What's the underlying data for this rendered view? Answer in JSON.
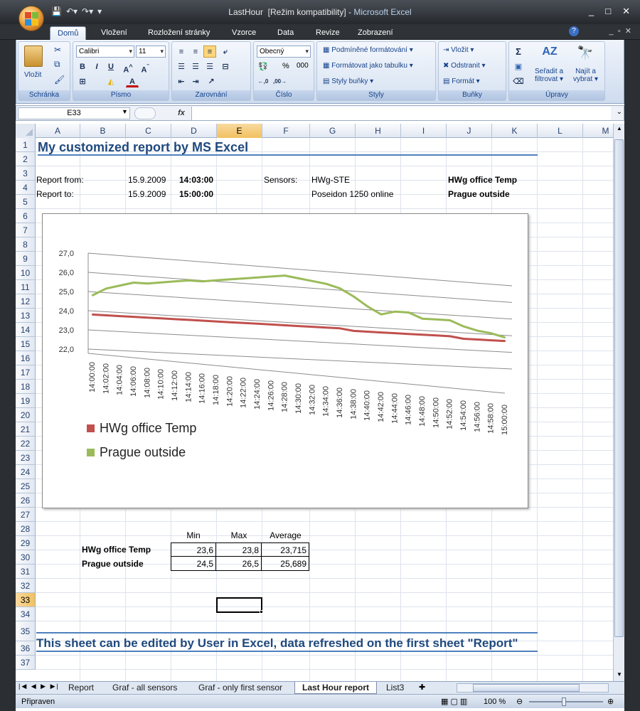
{
  "window": {
    "filename": "LastHour",
    "mode": "[Režim kompatibility]",
    "separator": " - ",
    "app": "Microsoft Excel"
  },
  "ribbon_tabs": [
    "Domů",
    "Vložení",
    "Rozložení stránky",
    "Vzorce",
    "Data",
    "Revize",
    "Zobrazení"
  ],
  "ribbon": {
    "clipboard": {
      "paste": "Vložit",
      "label": "Schránka"
    },
    "font": {
      "name": "Calibri",
      "size": "11",
      "label": "Písmo"
    },
    "alignment": {
      "label": "Zarovnání"
    },
    "number": {
      "format": "Obecný",
      "percent": "%",
      "thousands": "000",
      "label": "Číslo"
    },
    "styles": {
      "conditional": "Podmíněné formátování",
      "as_table": "Formátovat jako tabulku",
      "cell_styles": "Styly buňky",
      "label": "Styly"
    },
    "cells": {
      "insert": "Vložit",
      "delete": "Odstranit",
      "format": "Formát",
      "label": "Buňky"
    },
    "editing": {
      "sort1": "Seřadit a",
      "sort2": "filtrovat",
      "find1": "Najít a",
      "find2": "vybrat",
      "label": "Úpravy"
    }
  },
  "formula_bar": {
    "name_box": "E33",
    "fx": "fx",
    "formula": ""
  },
  "columns": [
    "A",
    "B",
    "C",
    "D",
    "E",
    "F",
    "G",
    "H",
    "I",
    "J",
    "K",
    "L",
    "M"
  ],
  "rows": [
    "1",
    "2",
    "3",
    "4",
    "5",
    "6",
    "7",
    "8",
    "9",
    "10",
    "11",
    "12",
    "13",
    "14",
    "15",
    "16",
    "17",
    "18",
    "19",
    "20",
    "21",
    "22",
    "23",
    "24",
    "25",
    "26",
    "27",
    "28",
    "29",
    "30",
    "31",
    "32",
    "33",
    "34",
    "35",
    "36",
    "37"
  ],
  "sheet": {
    "title": "My customized report by MS Excel",
    "report_from_label": "Report from:",
    "report_from_date": "15.9.2009",
    "report_from_time": "14:03:00",
    "report_to_label": "Report to:",
    "report_to_date": "15.9.2009",
    "report_to_time": "15:00:00",
    "sensors_label": "Sensors:",
    "sensor1_device": "HWg-STE",
    "sensor2_device": "Poseidon 1250 online",
    "sensor1_name": "HWg office Temp",
    "sensor2_name": "Prague outside",
    "stats_headers": [
      "Min",
      "Max",
      "Average"
    ],
    "stats_rows": [
      {
        "name": "HWg office Temp",
        "min": "23,6",
        "max": "23,8",
        "avg": "23,715"
      },
      {
        "name": "Prague outside",
        "min": "24,5",
        "max": "26,5",
        "avg": "25,689"
      }
    ],
    "footer": "This sheet can be edited by User in Excel, data refreshed on the first sheet \"Report\""
  },
  "chart_data": {
    "type": "line",
    "x": [
      "14:00:00",
      "14:02:00",
      "14:04:00",
      "14:06:00",
      "14:08:00",
      "14:10:00",
      "14:12:00",
      "14:14:00",
      "14:16:00",
      "14:18:00",
      "14:20:00",
      "14:22:00",
      "14:24:00",
      "14:26:00",
      "14:28:00",
      "14:30:00",
      "14:32:00",
      "14:34:00",
      "14:36:00",
      "14:38:00",
      "14:40:00",
      "14:42:00",
      "14:44:00",
      "14:46:00",
      "14:48:00",
      "14:50:00",
      "14:52:00",
      "14:54:00",
      "14:56:00",
      "14:58:00",
      "15:00:00"
    ],
    "y_ticks": [
      "22,0",
      "23,0",
      "24,0",
      "25,0",
      "26,0",
      "27,0"
    ],
    "ylim": [
      22,
      27
    ],
    "series": [
      {
        "name": "HWg office Temp",
        "color": "#c0504d",
        "values": [
          23.8,
          23.8,
          23.8,
          23.8,
          23.8,
          23.8,
          23.8,
          23.8,
          23.8,
          23.8,
          23.8,
          23.8,
          23.8,
          23.8,
          23.8,
          23.8,
          23.8,
          23.8,
          23.8,
          23.7,
          23.7,
          23.7,
          23.7,
          23.7,
          23.7,
          23.7,
          23.7,
          23.6,
          23.6,
          23.6,
          23.6
        ]
      },
      {
        "name": "Prague outside",
        "color": "#9bbb59",
        "values": [
          24.8,
          25.2,
          25.4,
          25.6,
          25.6,
          25.7,
          25.8,
          25.9,
          25.9,
          26.0,
          26.1,
          26.2,
          26.3,
          26.4,
          26.5,
          26.4,
          26.3,
          26.2,
          26.0,
          25.6,
          25.1,
          24.7,
          24.9,
          24.9,
          24.6,
          24.6,
          24.6,
          24.3,
          24.1,
          24.0,
          23.8
        ]
      }
    ],
    "legend_position": "bottom-left",
    "grid": true
  },
  "sheet_tabs": [
    "Report",
    "Graf - all sensors",
    "Graf - only first sensor",
    "Last Hour report",
    "List3"
  ],
  "active_tab": "Last Hour report",
  "status": {
    "ready": "Připraven",
    "zoom": "100 %"
  }
}
